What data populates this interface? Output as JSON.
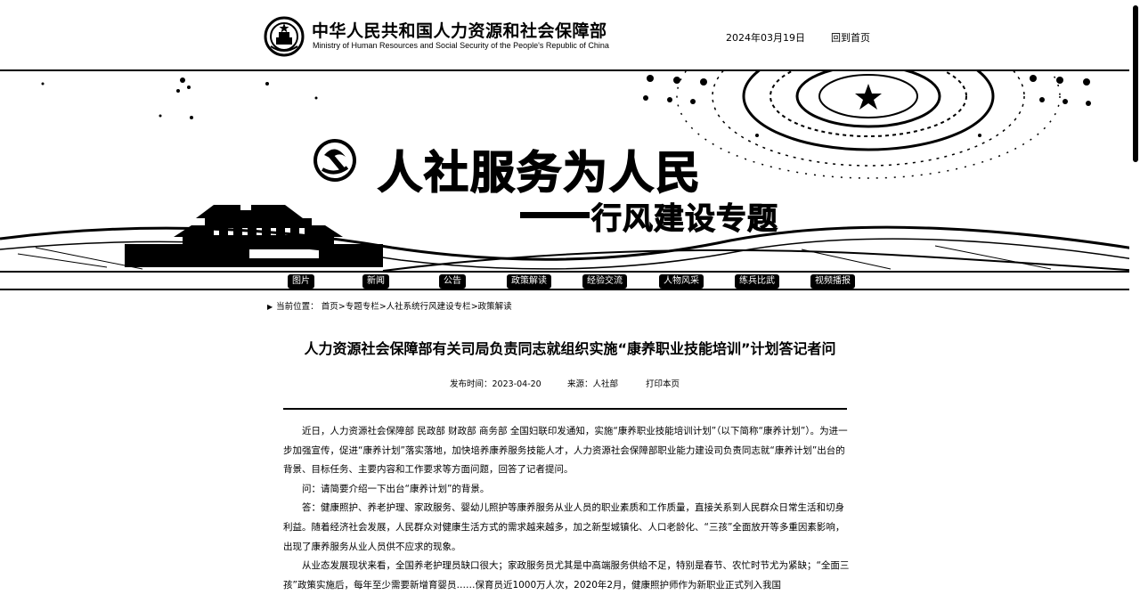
{
  "header": {
    "title_cn": "中华人民共和国人力资源和社会保障部",
    "title_en": "Ministry of Human Resources and Social Security of the People's Republic of China",
    "date": "2024年03月19日",
    "home_link": "回到首页"
  },
  "banner": {
    "title": "人社服务为人民",
    "subtitle": "行风建设专题"
  },
  "nav": {
    "items": [
      "图片",
      "新闻",
      "公告",
      "政策解读",
      "经验交流",
      "人物风采",
      "练兵比武",
      "视频播报"
    ]
  },
  "breadcrumb": {
    "label": "当前位置：",
    "items": [
      "首页",
      "专题专栏",
      "人社系统行风建设专栏",
      "政策解读"
    ],
    "separator": ">"
  },
  "article": {
    "title": "人力资源社会保障部有关司局负责同志就组织实施“康养职业技能培训”计划答记者问",
    "publish_label": "发布时间：",
    "publish_date": "2023-04-20",
    "source_label": "来源：",
    "source": "人社部",
    "print_label": "打印本页",
    "paragraphs": [
      "近日，人力资源社会保障部 民政部 财政部 商务部 全国妇联印发通知，实施“康养职业技能培训计划”（以下简称“康养计划”）。为进一步加强宣传，促进“康养计划”落实落地，加快培养康养服务技能人才，人力资源社会保障部职业能力建设司负责同志就“康养计划”出台的背景、目标任务、主要内容和工作要求等方面问题，回答了记者提问。",
      "问：请简要介绍一下出台“康养计划”的背景。",
      "答：健康照护、养老护理、家政服务、婴幼儿照护等康养服务从业人员的职业素质和工作质量，直接关系到人民群众日常生活和切身利益。随着经济社会发展，人民群众对健康生活方式的需求越来越多，加之新型城镇化、人口老龄化、“三孩”全面放开等多重因素影响，出现了康养服务从业人员供不应求的现象。",
      "从业态发展现状来看，全国养老护理员缺口很大；家政服务员尤其是中高端服务供给不足，特别是春节、农忙时节尤为紧缺；“全面三孩”政策实施后，每年至少需要新增育婴员……保育员近1000万人次，2020年2月，健康照护师作为新职业正式列入我国"
    ]
  },
  "colors": {
    "ink": "#000000",
    "paper": "#ffffff"
  }
}
